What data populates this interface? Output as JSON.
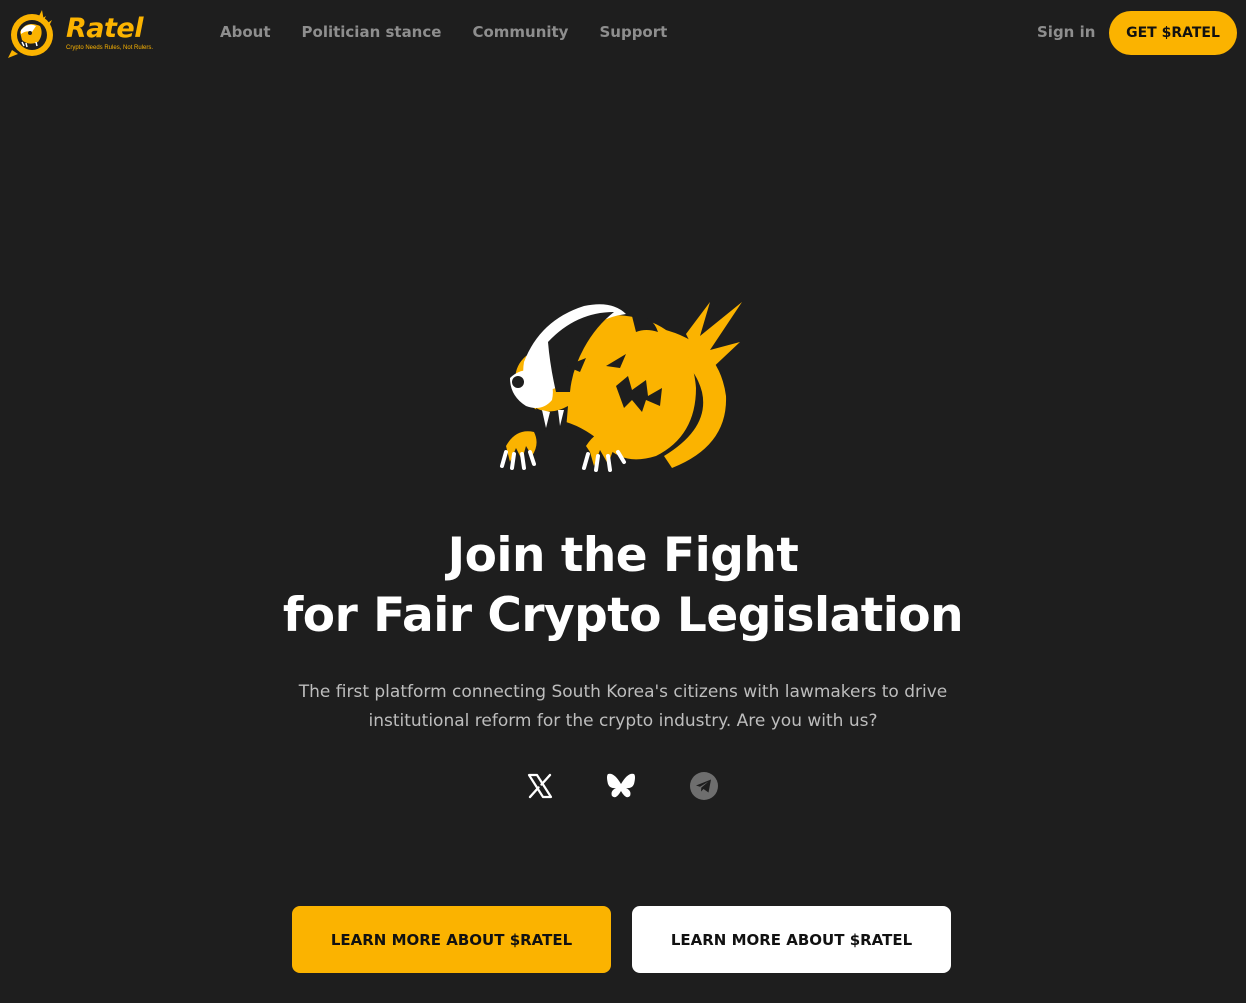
{
  "brand": {
    "name": "Ratel",
    "tagline": "Crypto Needs Rules, Not Rulers.",
    "accent_color": "#fbb300",
    "background_color": "#1e1e1e"
  },
  "nav": {
    "items": [
      {
        "label": "About"
      },
      {
        "label": "Politician stance"
      },
      {
        "label": "Community"
      },
      {
        "label": "Support"
      }
    ],
    "sign_in": "Sign in",
    "cta": "GET $RATEL"
  },
  "hero": {
    "mascot_icon": "honey-badger-mascot-icon",
    "title_line1": "Join the Fight",
    "title_line2": "for Fair Crypto Legislation",
    "subtitle": "The first platform connecting South Korea's citizens with lawmakers to drive institutional reform for the crypto industry. Are you with us?"
  },
  "social": [
    {
      "icon": "x-icon"
    },
    {
      "icon": "bluesky-icon"
    },
    {
      "icon": "telegram-icon"
    }
  ],
  "cta_buttons": {
    "primary": "LEARN MORE ABOUT $RATEL",
    "secondary": "LEARN MORE ABOUT $RATEL"
  }
}
